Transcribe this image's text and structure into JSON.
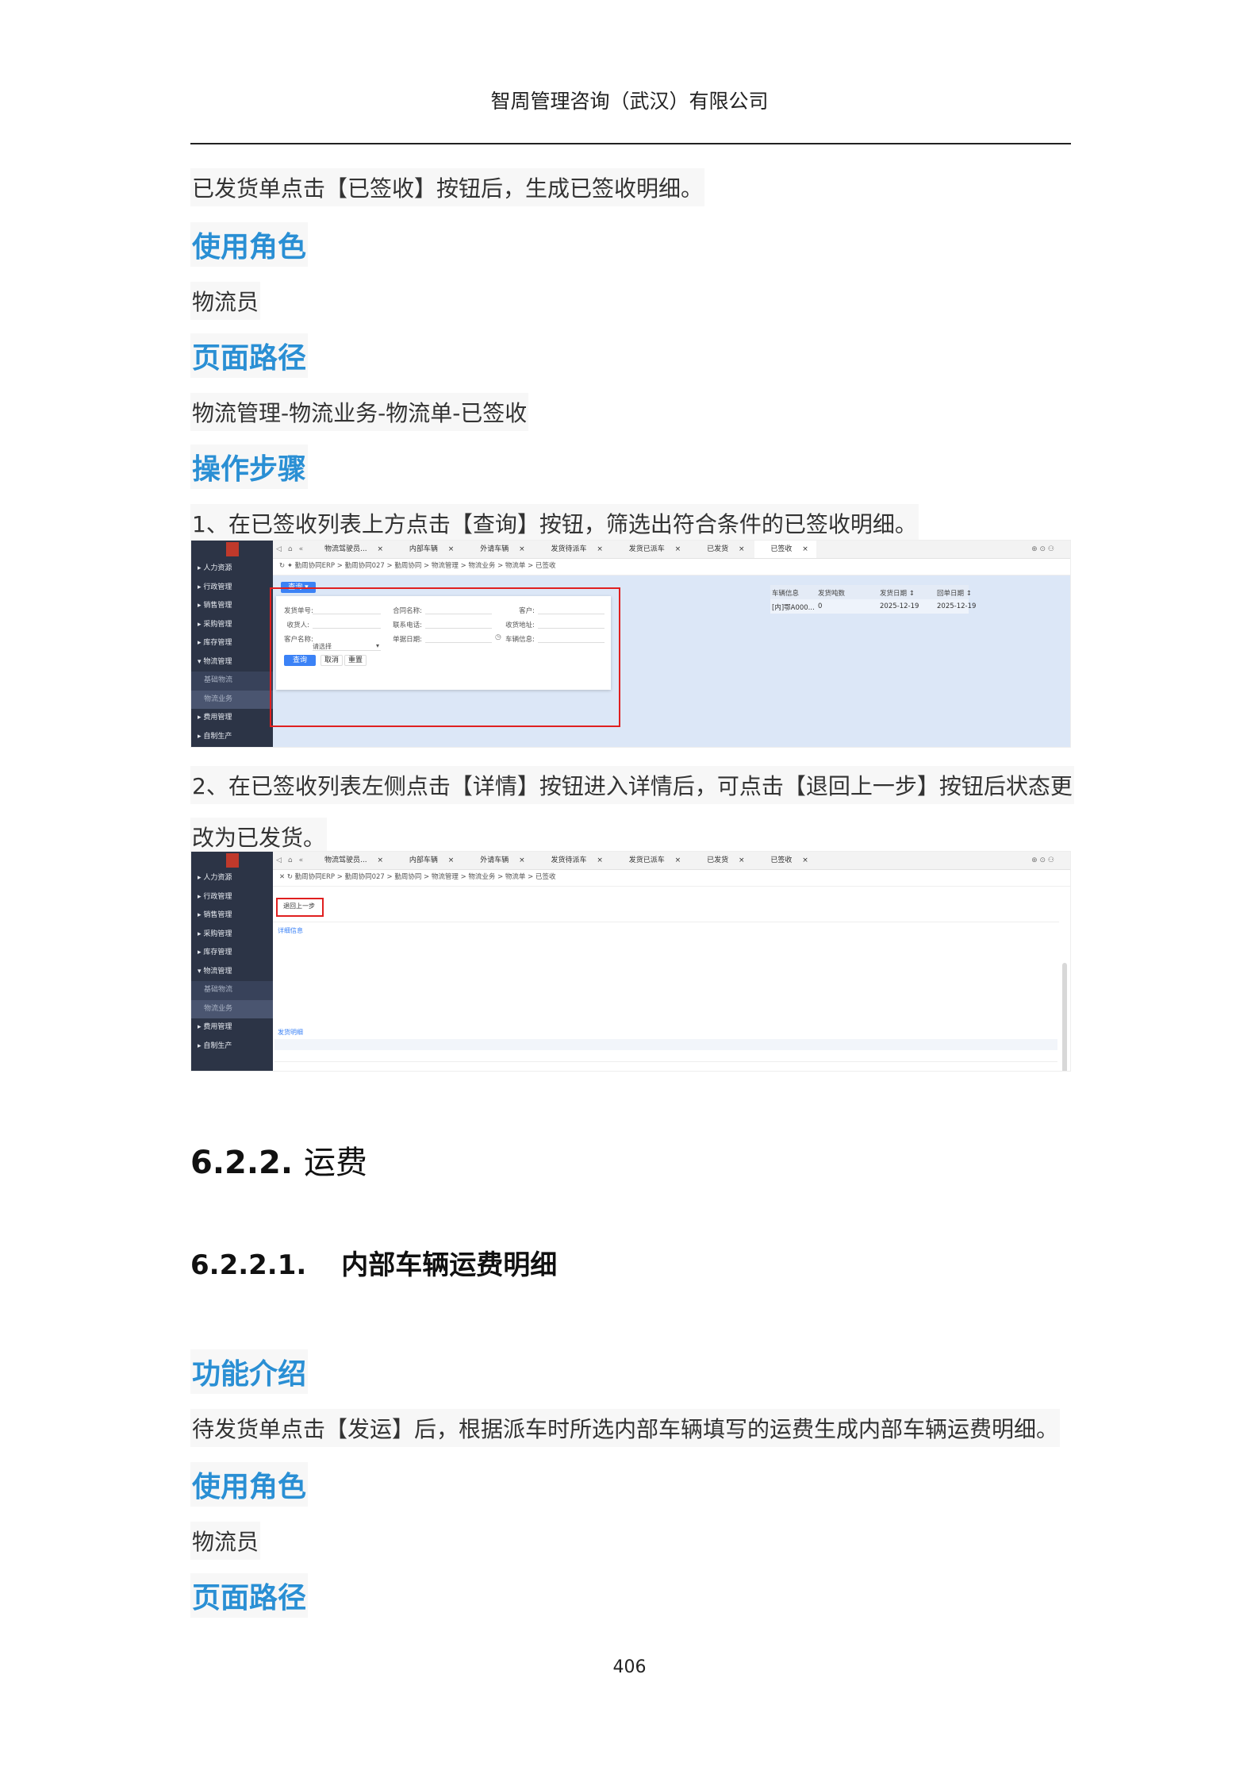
{
  "header": {
    "company": "智周管理咨询（武汉）有限公司"
  },
  "intro_line": "已发货单点击【已签收】按钮后，生成已签收明细。",
  "sec_role_title": "使用角色",
  "role": "物流员",
  "sec_path_title": "页面路径",
  "path": "物流管理-物流业务-物流单-已签收",
  "sec_steps_title": "操作步骤",
  "step1": "1、在已签收列表上方点击【查询】按钮，筛选出符合条件的已签收明细。",
  "step2_line1": "2、在已签收列表左侧点击【详情】按钮进入详情后，可点击【退回上一步】按钮后状态更",
  "step2_line2": "改为已发货。",
  "screenshot1": {
    "sidebar": [
      "人力资源",
      "行政管理",
      "销售管理",
      "采购管理",
      "库存管理",
      "物流管理",
      "基础物流",
      "物流业务",
      "费用管理",
      "自制生产"
    ],
    "tabs": [
      "物流驾驶员...",
      "内部车辆",
      "外请车辆",
      "发货待派车",
      "发货已派车",
      "已发货",
      "已签收"
    ],
    "breadcrumb": "勤周协同ERP > 勤周协同027 > 勤周协同 > 物流管理 > 物流业务 > 物流单 > 已签收",
    "query_button": "查询",
    "form_labels": [
      "发货单号:",
      "合同名称:",
      "客户:",
      "收货人:",
      "联系电话:",
      "收货地址:",
      "客户名称:",
      "单据日期:",
      "车辆信息:"
    ],
    "customer_select_placeholder": "请选择",
    "form_buttons": [
      "查询",
      "取消",
      "重置"
    ],
    "table_headers": [
      "车辆信息",
      "发货吨数",
      "发货日期 ↕",
      "回单日期 ↕"
    ],
    "table_row": [
      "[内]鄂A000...",
      "0",
      "2025-12-19",
      "2025-12-19"
    ]
  },
  "section_622": {
    "num": "6.2.2.",
    "title": "运费"
  },
  "section_6221": {
    "num": "6.2.2.1.",
    "title": "内部车辆运费明细"
  },
  "sec_func_title": "功能介绍",
  "func_desc": "待发货单点击【发运】后，根据派车时所选内部车辆填写的运费生成内部车辆运费明细。",
  "sec_role_title2": "使用角色",
  "role2": "物流员",
  "sec_path_title2": "页面路径",
  "page_number": "406"
}
